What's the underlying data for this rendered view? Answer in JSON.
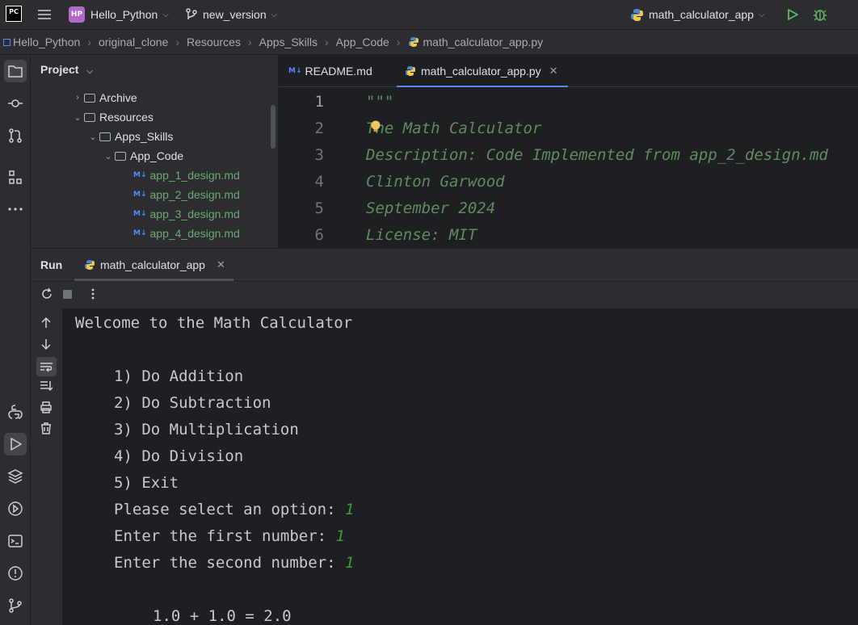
{
  "titlebar": {
    "logo": "PC",
    "project_badge": "HP",
    "project_name": "Hello_Python",
    "branch": "new_version",
    "run_config": "math_calculator_app",
    "icons": [
      "hamburger-menu-icon",
      "branch-icon",
      "python-icon",
      "run-icon",
      "debug-icon"
    ]
  },
  "breadcrumb": {
    "items": [
      "Hello_Python",
      "original_clone",
      "Resources",
      "Apps_Skills",
      "App_Code",
      "math_calculator_app.py"
    ]
  },
  "project_panel": {
    "title": "Project",
    "tree": [
      {
        "label": "Archive",
        "type": "folder",
        "expanded": false
      },
      {
        "label": "Resources",
        "type": "folder",
        "expanded": true
      },
      {
        "label": "Apps_Skills",
        "type": "folder",
        "expanded": true
      },
      {
        "label": "App_Code",
        "type": "folder",
        "expanded": true
      },
      {
        "label": "app_1_design.md",
        "type": "md"
      },
      {
        "label": "app_2_design.md",
        "type": "md"
      },
      {
        "label": "app_3_design.md",
        "type": "md"
      },
      {
        "label": "app_4_design.md",
        "type": "md"
      }
    ]
  },
  "editor": {
    "tabs": [
      {
        "label": "README.md",
        "icon": "markdown-icon",
        "active": false
      },
      {
        "label": "math_calculator_app.py",
        "icon": "python-icon",
        "active": true
      }
    ],
    "line_numbers": [
      "1",
      "2",
      "3",
      "4",
      "5",
      "6"
    ],
    "lines": [
      "\"\"\"",
      "The Math Calculator",
      "Description: Code Implemented from app_2_design.md",
      "Clinton Garwood",
      "September 2024",
      "License: MIT"
    ]
  },
  "run_panel": {
    "title": "Run",
    "tab_label": "math_calculator_app",
    "console": {
      "welcome": "Welcome to the Math Calculator",
      "menu": [
        "1) Do Addition",
        "2) Do Subtraction",
        "3) Do Multiplication",
        "4) Do Division",
        "5) Exit"
      ],
      "prompts": [
        {
          "text": "Please select an option: ",
          "input": "1"
        },
        {
          "text": "Enter the first number: ",
          "input": "1"
        },
        {
          "text": "Enter the second number: ",
          "input": "1"
        }
      ],
      "result": "1.0 + 1.0 = 2.0"
    }
  },
  "colors": {
    "accent": "#548af7",
    "doc_comment": "#5f8c5f",
    "user_input": "#3d9b3d",
    "run_green": "#5fb865"
  }
}
